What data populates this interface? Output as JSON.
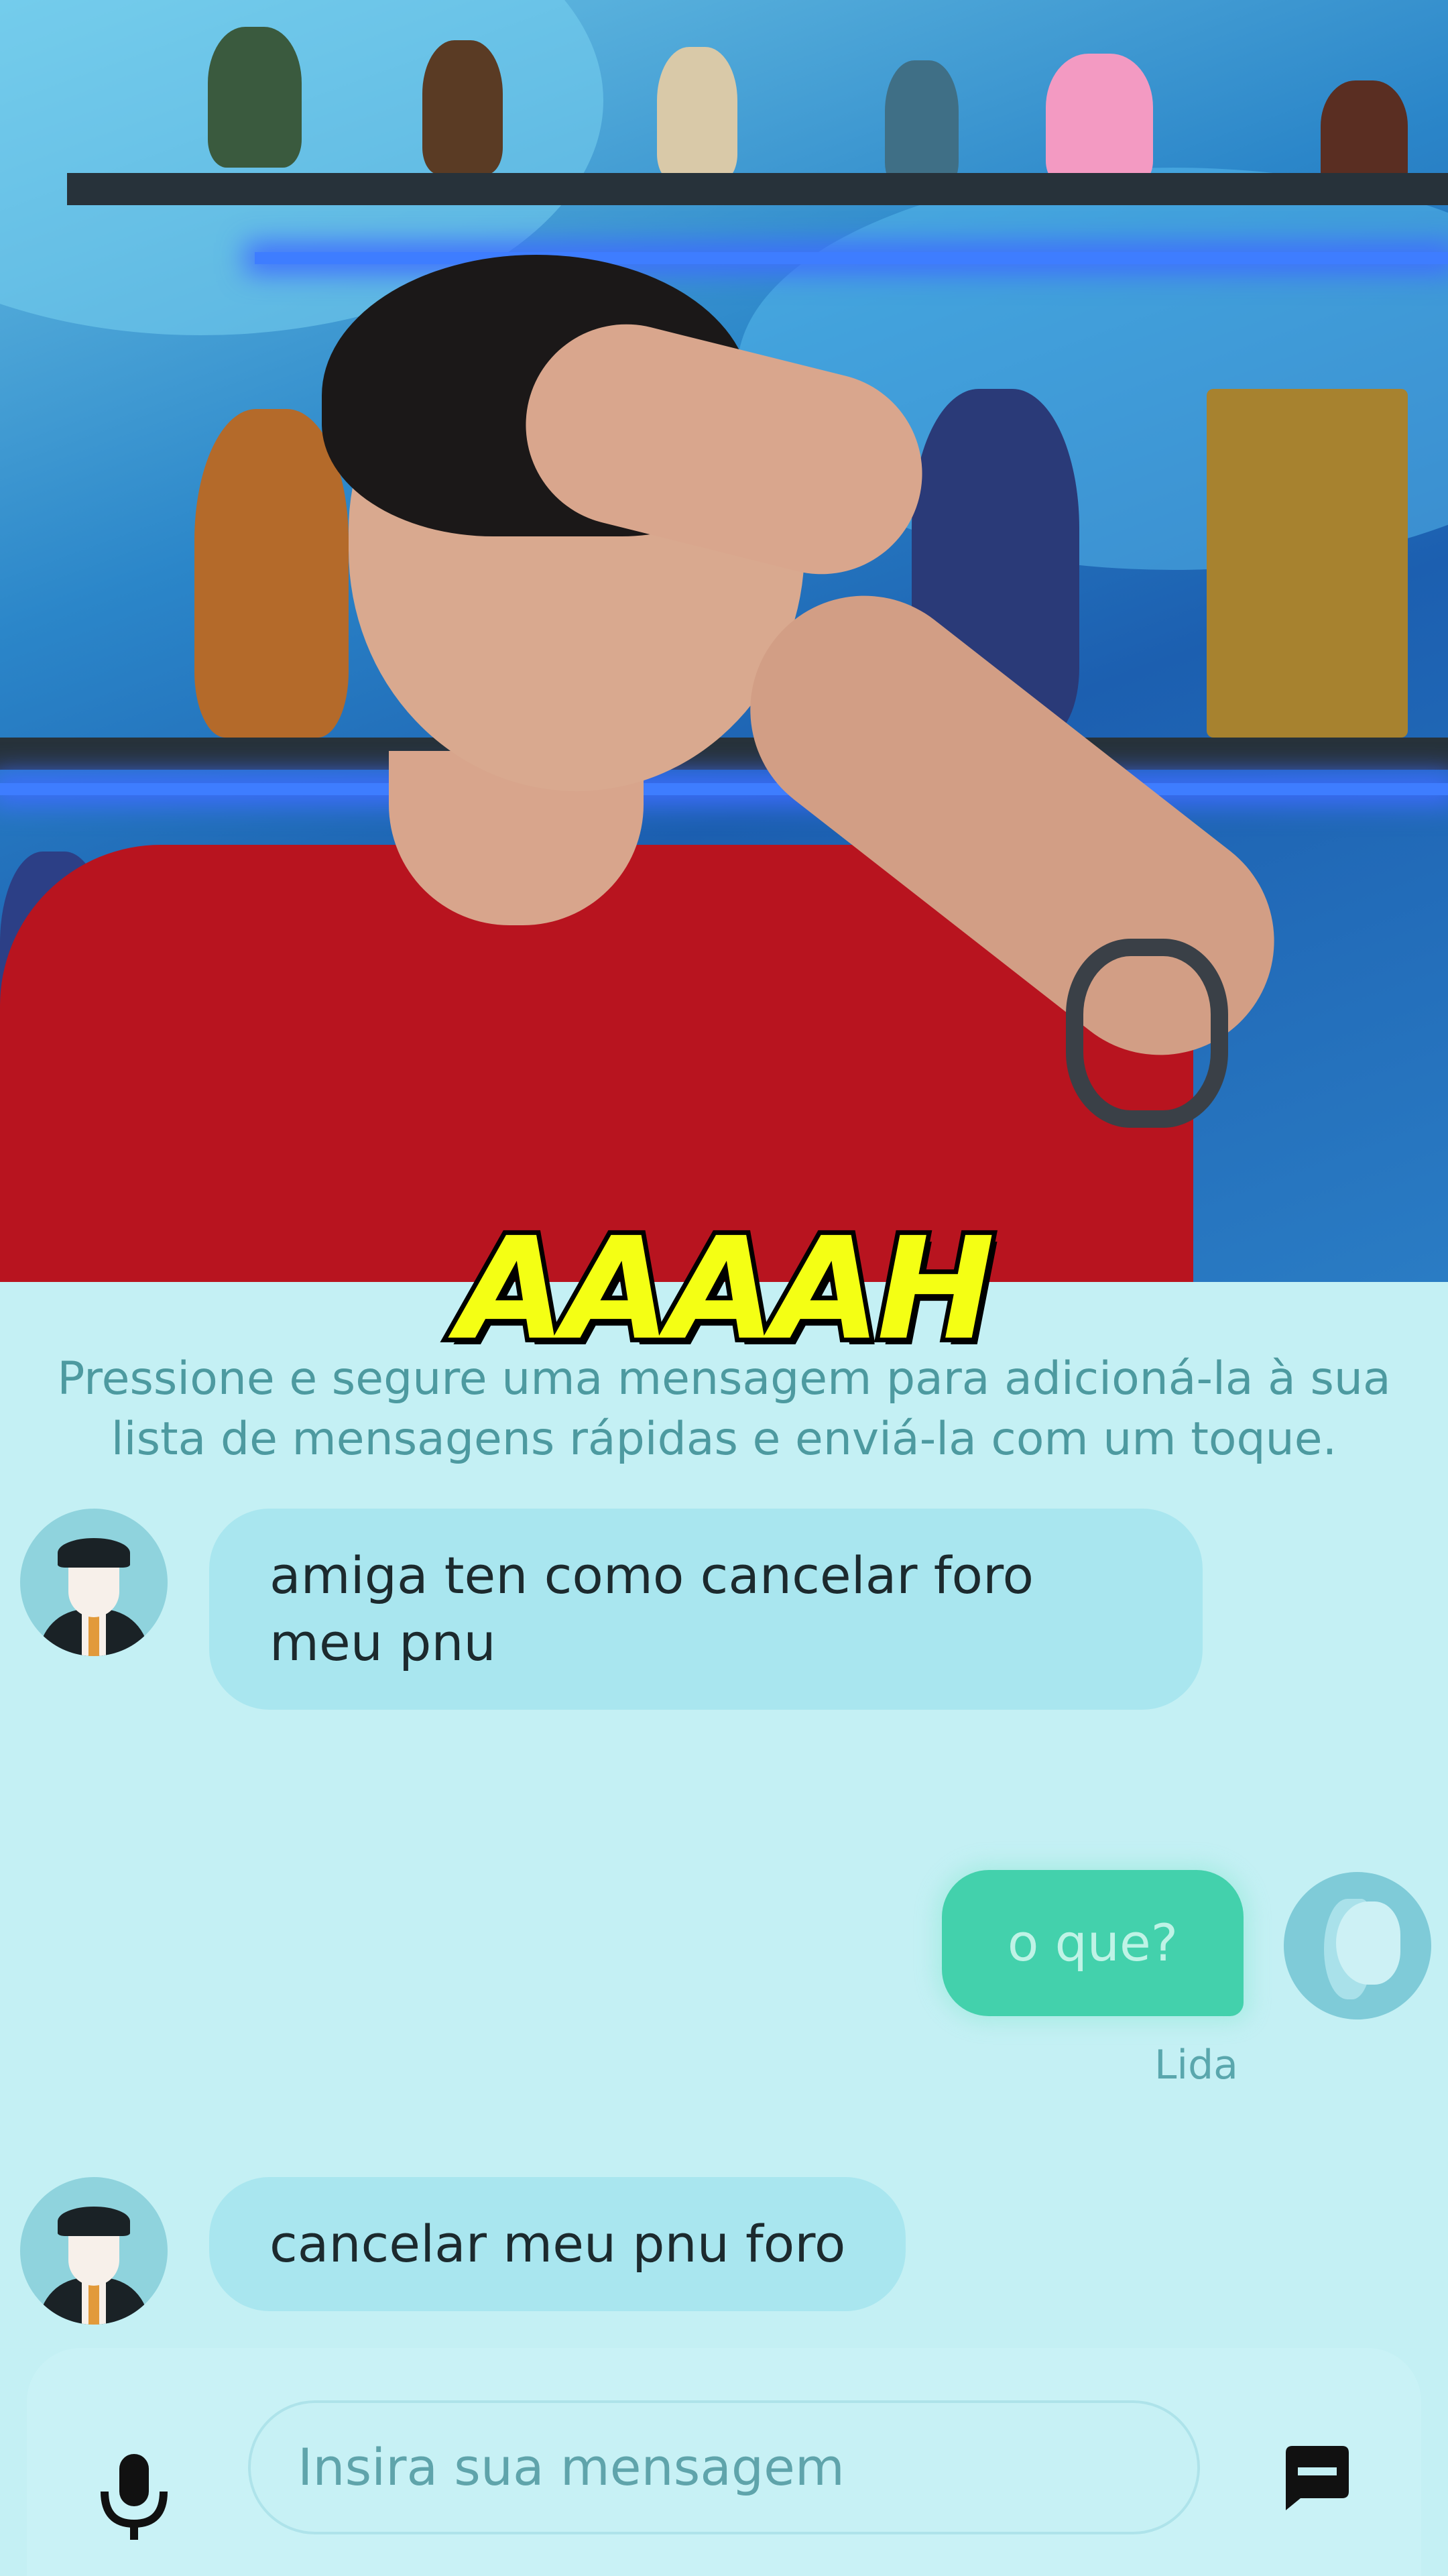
{
  "caption": {
    "text": "AAAAH"
  },
  "chat": {
    "hint": "Pressione e segure uma mensagem para adicioná-la à sua lista de mensagens rápidas e enviá-la com um toque.",
    "messages": [
      {
        "sender": "driver",
        "text": "amiga ten como cancelar foro meu pnu"
      },
      {
        "sender": "user",
        "text": "o que?",
        "status": "Lida"
      },
      {
        "sender": "driver",
        "text": "cancelar meu pnu foro"
      }
    ]
  },
  "composer": {
    "placeholder": "Insira sua mensagem",
    "mic_icon": "microphone-icon",
    "send_icon": "message-icon"
  },
  "colors": {
    "background": "#c4f0f4",
    "incoming_bubble": "#a9e6ef",
    "outgoing_bubble": "#43d1ac",
    "caption": "#f4ff14"
  }
}
